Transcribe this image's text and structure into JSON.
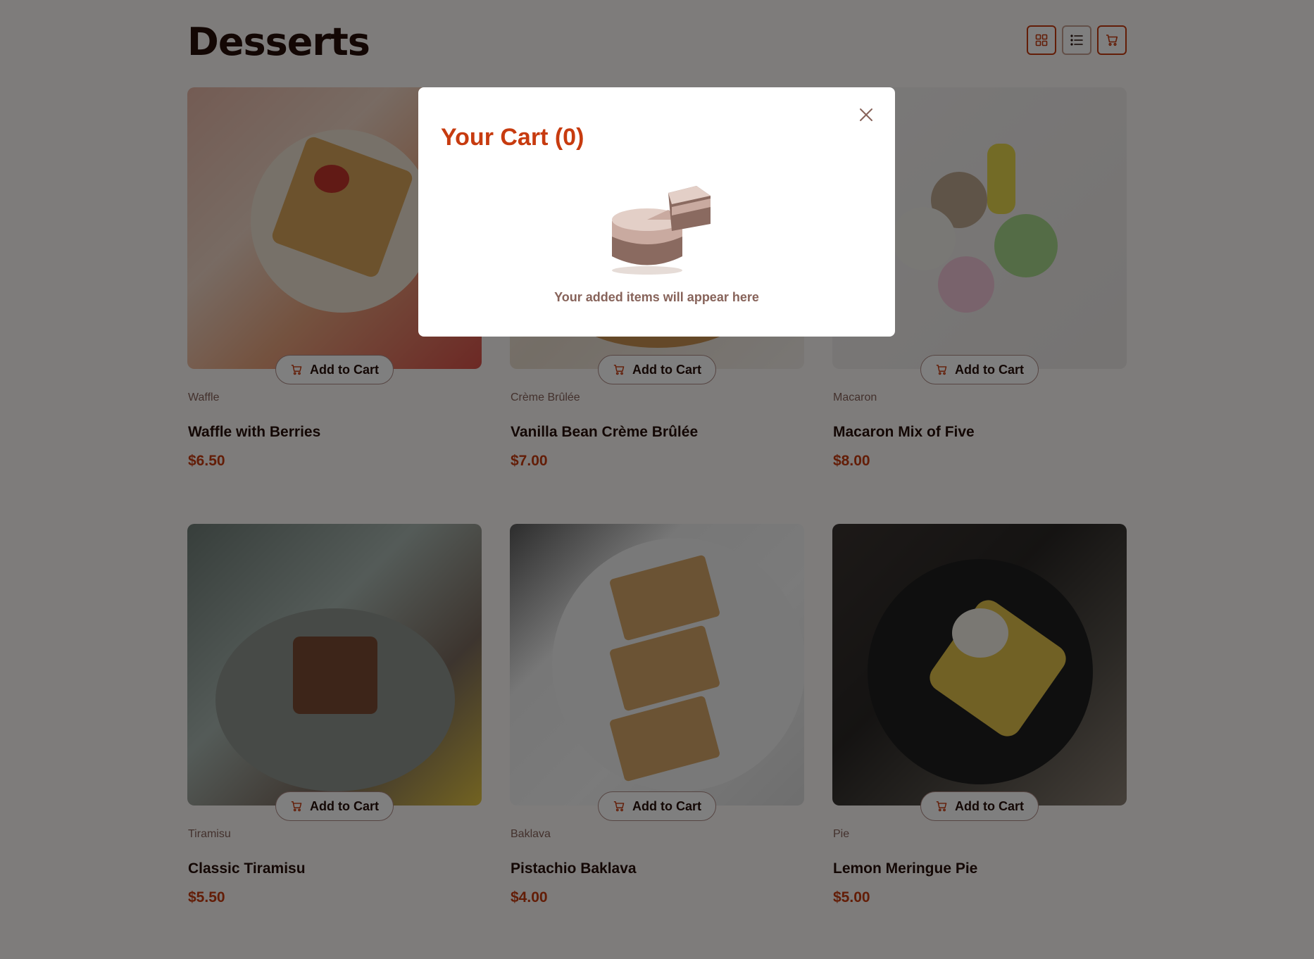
{
  "page": {
    "title": "Desserts"
  },
  "view_controls": [
    {
      "icon": "grid-icon"
    },
    {
      "icon": "list-icon"
    },
    {
      "icon": "cart-icon"
    }
  ],
  "products": [
    {
      "category": "Waffle",
      "name": "Waffle with Berries",
      "price": "$6.50",
      "button": "Add to Cart"
    },
    {
      "category": "Crème Brûlée",
      "name": "Vanilla Bean Crème Brûlée",
      "price": "$7.00",
      "button": "Add to Cart"
    },
    {
      "category": "Macaron",
      "name": "Macaron Mix of Five",
      "price": "$8.00",
      "button": "Add to Cart"
    },
    {
      "category": "Tiramisu",
      "name": "Classic Tiramisu",
      "price": "$5.50",
      "button": "Add to Cart"
    },
    {
      "category": "Baklava",
      "name": "Pistachio Baklava",
      "price": "$4.00",
      "button": "Add to Cart"
    },
    {
      "category": "Pie",
      "name": "Lemon Meringue Pie",
      "price": "$5.00",
      "button": "Add to Cart"
    }
  ],
  "cart_modal": {
    "title": "Your Cart (0)",
    "empty_message": "Your added items will appear here"
  },
  "colors": {
    "accent": "#c73b0f",
    "text_dark": "#260f08",
    "text_muted": "#87635a",
    "background": "#fcf8f6"
  }
}
